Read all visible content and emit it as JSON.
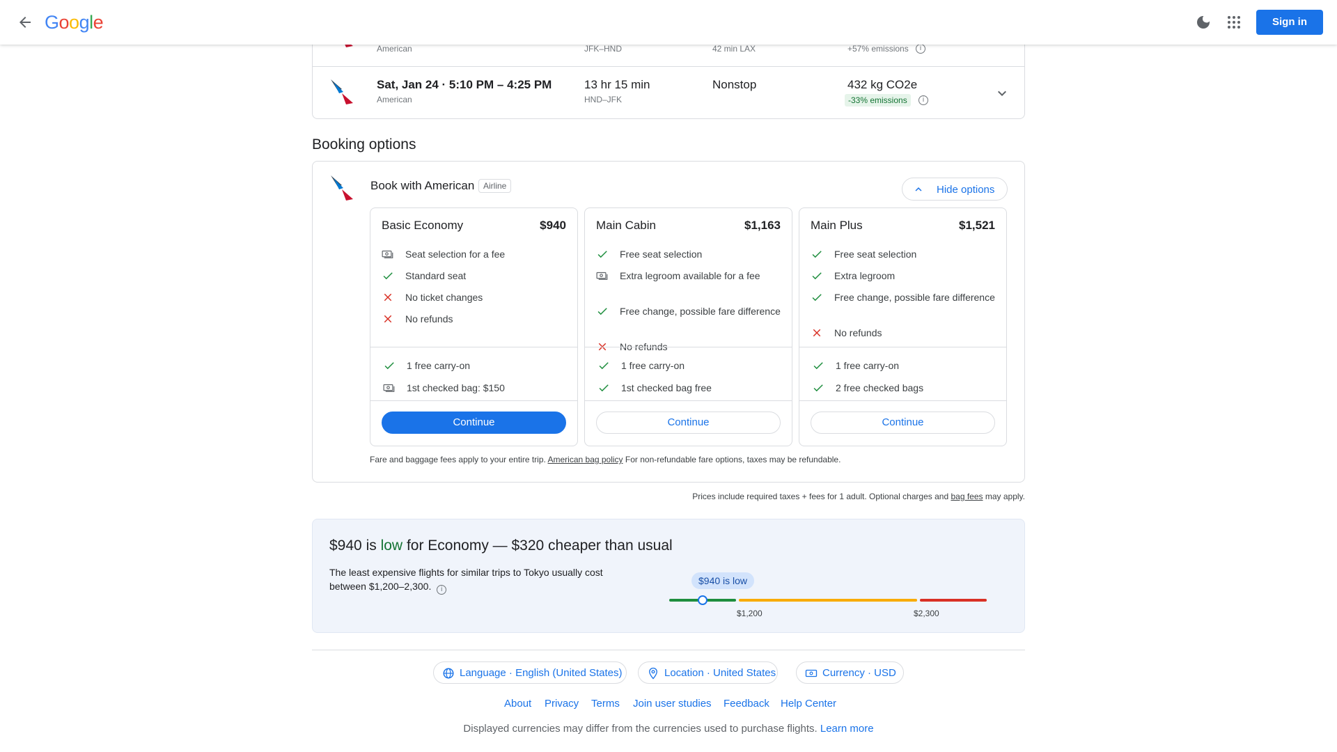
{
  "header": {
    "logo_letters": [
      {
        "ch": "G",
        "color": "#4285F4"
      },
      {
        "ch": "o",
        "color": "#EA4335"
      },
      {
        "ch": "o",
        "color": "#FBBC05"
      },
      {
        "ch": "g",
        "color": "#4285F4"
      },
      {
        "ch": "l",
        "color": "#34A853"
      },
      {
        "ch": "e",
        "color": "#EA4335"
      }
    ],
    "sign_in": "Sign in"
  },
  "flights": {
    "row1": {
      "airline": "American",
      "route": "JFK–HND",
      "stops_detail": "42 min LAX",
      "emissions_badge": "+57% emissions"
    },
    "row2": {
      "times": "Sat, Jan 24  ·  5:10 PM – 4:25 PM",
      "airline": "American",
      "duration": "13 hr 15 min",
      "route": "HND–JFK",
      "stops": "Nonstop",
      "emissions": "432 kg CO2e",
      "emissions_badge": "-33% emissions"
    }
  },
  "booking": {
    "title": "Booking options",
    "book_with": "Book with American",
    "tag": "Airline",
    "hide_options": "Hide options",
    "fares": [
      {
        "name": "Basic Economy",
        "price": "$940",
        "features": [
          {
            "icon": "money-icon",
            "text": "Seat selection for a fee"
          },
          {
            "icon": "check-icon",
            "text": "Standard seat"
          },
          {
            "icon": "close-icon",
            "text": "No ticket changes"
          },
          {
            "icon": "close-icon",
            "text": "No refunds"
          }
        ],
        "bags": [
          {
            "icon": "check-icon",
            "text": "1 free carry-on"
          },
          {
            "icon": "money-icon",
            "text": "1st checked bag: $150"
          }
        ],
        "continue": "Continue",
        "primary": true
      },
      {
        "name": "Main Cabin",
        "price": "$1,163",
        "features": [
          {
            "icon": "check-icon",
            "text": "Free seat selection"
          },
          {
            "icon": "money-icon",
            "text": "Extra legroom available for a fee"
          },
          {
            "icon": "check-icon",
            "text": "Free change, possible fare difference"
          },
          {
            "icon": "close-icon",
            "text": "No refunds"
          }
        ],
        "bags": [
          {
            "icon": "check-icon",
            "text": "1 free carry-on"
          },
          {
            "icon": "check-icon",
            "text": "1st checked bag free"
          }
        ],
        "continue": "Continue",
        "primary": false
      },
      {
        "name": "Main Plus",
        "price": "$1,521",
        "features": [
          {
            "icon": "check-icon",
            "text": "Free seat selection"
          },
          {
            "icon": "check-icon",
            "text": "Extra legroom"
          },
          {
            "icon": "check-icon",
            "text": "Free change, possible fare difference"
          },
          {
            "icon": "close-icon",
            "text": "No refunds"
          }
        ],
        "bags": [
          {
            "icon": "check-icon",
            "text": "1 free carry-on"
          },
          {
            "icon": "check-icon",
            "text": "2 free checked bags"
          }
        ],
        "continue": "Continue",
        "primary": false
      }
    ],
    "fee_note_before": "Fare and baggage fees apply to your entire trip.",
    "fee_note_link": "American bag policy",
    "fee_note_after": "For non-refundable fare options, taxes may be refundable."
  },
  "price_note": {
    "before": "Prices include required taxes + fees for 1 adult. Optional charges and",
    "link": "bag fees",
    "after": "may apply."
  },
  "insight": {
    "price": "$940",
    "is": "is",
    "level": "low",
    "rest": "for Economy — $320 cheaper than usual",
    "text": "The least expensive flights for similar trips to Tokyo usually cost between $1,200–2,300.",
    "bubble": "$940 is low",
    "tick_low": "$1,200",
    "tick_high": "$2,300",
    "colors": {
      "low": "#1e8e3e",
      "typical": "#f9ab00",
      "high": "#d93025"
    }
  },
  "footer": {
    "language": "Language · English (United States)",
    "location": "Location · United States",
    "currency": "Currency · USD",
    "links": [
      "About",
      "Privacy",
      "Terms",
      "Join user studies",
      "Feedback",
      "Help Center"
    ],
    "disclaimer": "Displayed currencies may differ from the currencies used to purchase flights.",
    "learn_more": "Learn more"
  }
}
